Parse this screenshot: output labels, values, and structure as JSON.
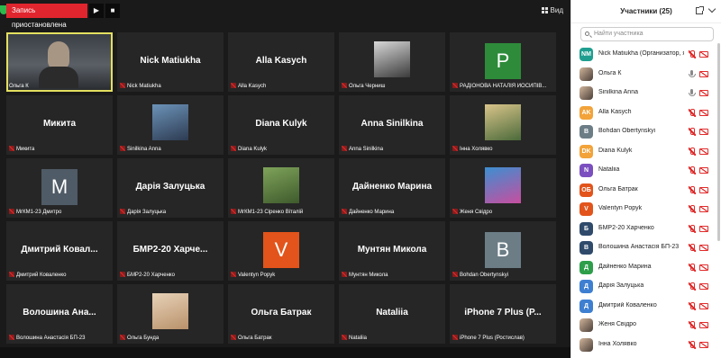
{
  "topbar": {
    "record_label": "Запись приостановлена",
    "play_glyph": "▶",
    "stop_glyph": "■",
    "view_label": "Вид"
  },
  "tiles": [
    {
      "type": "camera",
      "footer": "Ольга К",
      "active": true
    },
    {
      "type": "name",
      "name": "Nick Matiukha",
      "footer": "Nick Matiukha"
    },
    {
      "type": "name",
      "name": "Alla Kasych",
      "footer": "Alla Kasych"
    },
    {
      "type": "photo",
      "footer": "Ольга Черниш",
      "colors": [
        "#d8d8d8",
        "#3b3b3b"
      ]
    },
    {
      "type": "avatar",
      "letter": "P",
      "color": "#2e8b3a",
      "footer": "РАДІОНОВА НАТАЛІЯ ЙОСИПІВ..."
    },
    {
      "type": "name",
      "name": "Микита",
      "footer": "Микита"
    },
    {
      "type": "photo",
      "footer": "Sinilkina Anna",
      "colors": [
        "#6c93b8",
        "#2d3b52"
      ]
    },
    {
      "type": "name",
      "name": "Diana Kulyk",
      "footer": "Diana Kulyk"
    },
    {
      "type": "name",
      "name": "Anna Sinilkina",
      "footer": "Anna Sinilkina"
    },
    {
      "type": "photo",
      "footer": "Інна Холявко",
      "colors": [
        "#d9c48a",
        "#4b6a3a"
      ]
    },
    {
      "type": "avatar",
      "letter": "M",
      "color": "#4f5b66",
      "footer": "МгКМ1-23 Дмитро"
    },
    {
      "type": "name",
      "name": "Дарія Залуцька",
      "footer": "Дарія Залуцька"
    },
    {
      "type": "photo",
      "footer": "МгКМ1-23 Сіренко Віталій",
      "colors": [
        "#7fa35a",
        "#3e5a2c"
      ]
    },
    {
      "type": "name",
      "name": "Дайненко Марина",
      "footer": "Дайненко Марина"
    },
    {
      "type": "photo",
      "footer": "Женя Свідро",
      "colors": [
        "#3c8fd1",
        "#c84e9f"
      ]
    },
    {
      "type": "name",
      "name": "Дмитрий Ковал...",
      "footer": "Дмитрий Коваленко"
    },
    {
      "type": "name",
      "name": "БМР2-20  Харче...",
      "footer": "БМР2-20 Харченко"
    },
    {
      "type": "avatar",
      "letter": "V",
      "color": "#e2541b",
      "footer": "Valentyn Popyk"
    },
    {
      "type": "name",
      "name": "Мунтян Микола",
      "footer": "Мунтян Микола"
    },
    {
      "type": "avatar",
      "letter": "B",
      "color": "#6c7d86",
      "footer": "Bohdan Obertynskyi"
    },
    {
      "type": "name",
      "name": "Волошина Ана...",
      "footer": "Волошина Анастасія БП-23"
    },
    {
      "type": "photo",
      "footer": "Ольга Бунда",
      "colors": [
        "#e8d2b8",
        "#b8916a"
      ]
    },
    {
      "type": "name",
      "name": "Ольга Батрак",
      "footer": "Ольга Батрак"
    },
    {
      "type": "name",
      "name": "Nataliia",
      "footer": "Nataliia"
    },
    {
      "type": "name",
      "name": "iPhone 7 Plus (P...",
      "footer": "iPhone 7 Plus (Ростислав)"
    }
  ],
  "panel": {
    "title": "Участники (25)",
    "search_placeholder": "Найти участника",
    "participants": [
      {
        "name": "Nick Matiukha (Организатор, я)",
        "initials": "NM",
        "color": "#1f9e8f",
        "mic": "off"
      },
      {
        "name": "Ольга К",
        "initials": "",
        "color": "photo",
        "mic": "on"
      },
      {
        "name": "Sinilkina Anna",
        "initials": "",
        "color": "photo",
        "mic": "on"
      },
      {
        "name": "Alla Kasych",
        "initials": "AK",
        "color": "#f2a33a",
        "mic": "off"
      },
      {
        "name": "Bohdan Obertynskyi",
        "initials": "B",
        "color": "#6c7d86",
        "mic": "off"
      },
      {
        "name": "Diana Kulyk",
        "initials": "DK",
        "color": "#f2a33a",
        "mic": "off"
      },
      {
        "name": "Nataliia",
        "initials": "N",
        "color": "#7b4fbf",
        "mic": "off"
      },
      {
        "name": "Ольга Батрак",
        "initials": "ОБ",
        "color": "#e2541b",
        "mic": "off"
      },
      {
        "name": "Valentyn Popyk",
        "initials": "V",
        "color": "#e2541b",
        "mic": "off"
      },
      {
        "name": "БМР2-20 Харченко",
        "initials": "Б",
        "color": "#2f4a6b",
        "mic": "off"
      },
      {
        "name": "Волошина Анастасія БП-23",
        "initials": "В",
        "color": "#2f4a6b",
        "mic": "off"
      },
      {
        "name": "Дайненко Марина",
        "initials": "Д",
        "color": "#2e9e4a",
        "mic": "off"
      },
      {
        "name": "Дарія Залуцька",
        "initials": "Д",
        "color": "#3e7fd1",
        "mic": "off"
      },
      {
        "name": "Дмитрий Коваленко",
        "initials": "Д",
        "color": "#3e7fd1",
        "mic": "off"
      },
      {
        "name": "Женя Свідро",
        "initials": "",
        "color": "photo",
        "mic": "off"
      },
      {
        "name": "Інна Холявко",
        "initials": "",
        "color": "photo",
        "mic": "off"
      }
    ]
  }
}
